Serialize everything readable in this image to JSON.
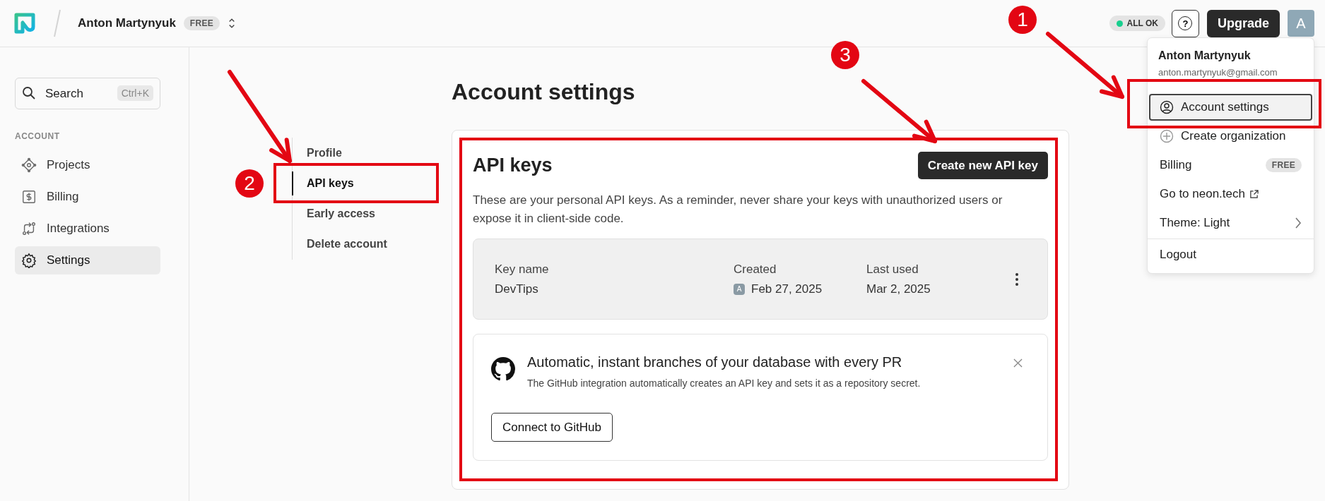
{
  "header": {
    "org_name": "Anton Martynyuk",
    "plan_badge": "FREE",
    "status": {
      "label": "ALL OK",
      "ok": true
    },
    "help": "?",
    "upgrade": "Upgrade",
    "avatar": "A"
  },
  "sidebar": {
    "search": {
      "placeholder": "Search",
      "shortcut": "Ctrl+K"
    },
    "section": "ACCOUNT",
    "items": [
      {
        "label": "Projects",
        "kind": "projects",
        "selected": false
      },
      {
        "label": "Billing",
        "kind": "billing",
        "selected": false
      },
      {
        "label": "Integrations",
        "kind": "integrations",
        "selected": false
      },
      {
        "label": "Settings",
        "kind": "settings",
        "selected": true
      }
    ]
  },
  "page_title": "Account settings",
  "subnav": [
    {
      "label": "Profile",
      "selected": false
    },
    {
      "label": "API keys",
      "selected": true
    },
    {
      "label": "Early access",
      "selected": false
    },
    {
      "label": "Delete account",
      "selected": false
    }
  ],
  "api_keys": {
    "title": "API keys",
    "create_button": "Create new API key",
    "description": "These are your personal API keys. As a reminder, never share your keys with unauthorized users or expose it in client-side code.",
    "columns": [
      "Key name",
      "Created",
      "Last used"
    ],
    "rows": [
      {
        "name": "DevTips",
        "creator": "A",
        "created": "Feb 27, 2025",
        "last_used": "Mar 2, 2025"
      }
    ],
    "promo": {
      "title": "Automatic, instant branches of your database with every PR",
      "text": "The GitHub integration automatically creates an API key and sets it as a repository secret.",
      "button": "Connect to GitHub"
    }
  },
  "user_menu": {
    "name": "Anton Martynyuk",
    "email": "anton.martynyuk@gmail.com",
    "items": [
      {
        "label": "Account settings",
        "kind": "account",
        "selected": true
      },
      {
        "label": "Create organization",
        "kind": "create",
        "selected": false
      },
      {
        "label": "Billing",
        "kind": "billing",
        "badge": "FREE",
        "selected": false
      },
      {
        "label": "Go to neon.tech",
        "kind": "link",
        "selected": false
      },
      {
        "label": "Theme: Light",
        "kind": "submenu",
        "selected": false
      },
      {
        "label": "Logout",
        "kind": "logout",
        "selected": false
      }
    ]
  },
  "annotations": [
    {
      "number": "1"
    },
    {
      "number": "2"
    },
    {
      "number": "3"
    }
  ]
}
